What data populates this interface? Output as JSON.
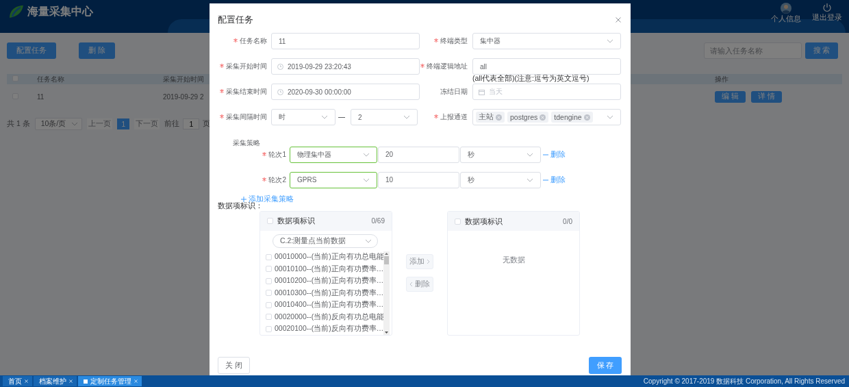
{
  "app": {
    "title": "海量采集中心",
    "user_links": [
      {
        "label": "个人信息",
        "kind": "avatar"
      },
      {
        "label": "退出登录",
        "kind": "power"
      }
    ]
  },
  "toolbar": {
    "buttons": [
      "配置任务",
      "删 除"
    ],
    "search": {
      "placeholder": "请输入任务名称"
    },
    "search_button": "搜 索"
  },
  "table": {
    "header_checked": false,
    "columns": [
      "任务名称",
      "采集开始时间",
      "操作"
    ],
    "rows": [
      {
        "checked": false,
        "cells": [
          "11",
          "2019-09-29 2"
        ],
        "actions": [
          "编 辑",
          "详 情"
        ]
      }
    ]
  },
  "pagination": {
    "total": "共 1 条",
    "page_size": "10条/页",
    "prev": {
      "label": "上一页",
      "disabled": true
    },
    "pages": [
      {
        "label": "1",
        "selected": true
      }
    ],
    "next": {
      "label": "下一页",
      "disabled": true
    },
    "goto_label": "前往",
    "goto_value": "1",
    "goto_unit": "页"
  },
  "dialog": {
    "title": "配置任务",
    "rows": [
      [
        {
          "label": "任务名称",
          "required": true,
          "kind": "input",
          "value": "11"
        },
        {
          "label": "终端类型",
          "required": true,
          "kind": "select",
          "value": "集中器"
        }
      ],
      [
        {
          "label": "采集开始时间",
          "required": true,
          "kind": "datetime",
          "value": "2019-09-29 23:20:43"
        },
        {
          "label": "终端逻辑地址",
          "required": true,
          "kind": "input",
          "value": "all",
          "hint": "(all代表全部)(注意:逗号为英文逗号)"
        }
      ],
      [
        {
          "label": "采集结束时间",
          "required": true,
          "kind": "datetime",
          "value": "2020-09-30 00:00:00"
        },
        {
          "label": "冻结日期",
          "required": false,
          "kind": "date",
          "placeholder": "当天"
        }
      ],
      [
        {
          "label": "采集间隔时间",
          "required": true,
          "kind": "interval",
          "values": [
            "时",
            "2"
          ]
        },
        {
          "label": "上报通道",
          "required": true,
          "kind": "tags",
          "tags": [
            "主站",
            "postgres",
            "tdengine"
          ]
        }
      ]
    ],
    "strategy": {
      "label": "采集策略",
      "rounds": [
        {
          "label": "轮次1",
          "required": true,
          "channel": "物理集中器",
          "valid": true,
          "value": "20",
          "unit": "秒",
          "remove": "删除"
        },
        {
          "label": "轮次2",
          "required": true,
          "channel": "GPRS",
          "valid": true,
          "value": "10",
          "unit": "秒",
          "remove": "删除"
        }
      ],
      "add": "添加采集策略"
    },
    "data_items": {
      "label": "数据项标识：",
      "source": {
        "title": "数据项标识",
        "checked": false,
        "count": "0/69",
        "filter": "C.2:测量点当前数据",
        "items": [
          {
            "label": "00010000--(当前)正向有功总电能",
            "checked": false
          },
          {
            "label": "00010100--(当前)正向有功费率…",
            "checked": false
          },
          {
            "label": "00010200--(当前)正向有功费率…",
            "checked": false
          },
          {
            "label": "00010300--(当前)正向有功费率…",
            "checked": false
          },
          {
            "label": "00010400--(当前)正向有功费率…",
            "checked": false
          },
          {
            "label": "00020000--(当前)反向有功总电能",
            "checked": false
          },
          {
            "label": "00020100--(当前)反向有功费率…",
            "checked": false
          }
        ]
      },
      "add_button": {
        "label": "添加",
        "disabled": true
      },
      "remove_button": {
        "label": "删除",
        "disabled": true
      },
      "target": {
        "title": "数据项标识",
        "checked": false,
        "count": "0/0",
        "empty": "无数据"
      }
    },
    "cancel": "关 闭",
    "save": "保 存"
  },
  "bottom_tabs": [
    {
      "label": "首页",
      "selected": false
    },
    {
      "label": "档案维护",
      "selected": false
    },
    {
      "label": "定制任务管理",
      "selected": true
    }
  ],
  "copyright": "Copyright © 2017-2019 数据科技 Corporation, All Rights Reserved"
}
